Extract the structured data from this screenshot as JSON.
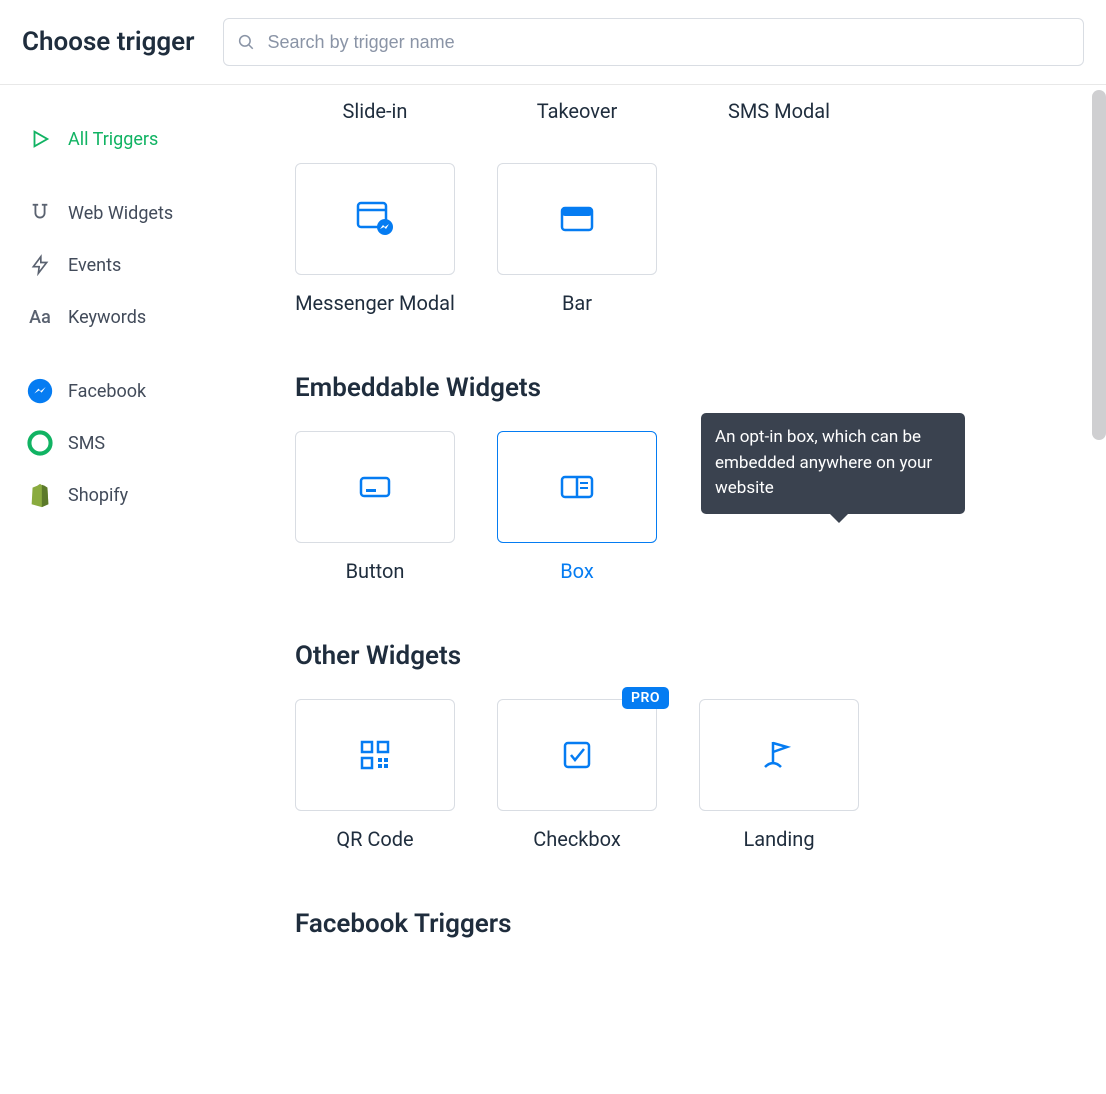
{
  "header": {
    "title": "Choose trigger",
    "search_placeholder": "Search by trigger name"
  },
  "sidebar": {
    "items": [
      {
        "label": "All Triggers",
        "icon": "play-icon",
        "active": true
      },
      {
        "label": "Web Widgets",
        "icon": "magnet-icon",
        "active": false
      },
      {
        "label": "Events",
        "icon": "lightning-icon",
        "active": false
      },
      {
        "label": "Keywords",
        "icon": "text-aa-icon",
        "active": false
      }
    ],
    "channels": [
      {
        "label": "Facebook",
        "icon": "messenger-circle-icon",
        "color": "#057cf2"
      },
      {
        "label": "SMS",
        "icon": "chat-circle-icon",
        "color": "#11b363"
      },
      {
        "label": "Shopify",
        "icon": "shopify-icon",
        "color": "#6a863a"
      }
    ]
  },
  "content": {
    "top_labels": [
      "Slide-in",
      "Takeover",
      "SMS Modal"
    ],
    "row2": [
      {
        "label": "Messenger Modal",
        "icon": "messenger-modal-icon"
      },
      {
        "label": "Bar",
        "icon": "bar-icon"
      }
    ],
    "sections": [
      {
        "title": "Embeddable Widgets",
        "items": [
          {
            "label": "Button",
            "icon": "button-icon",
            "selected": false
          },
          {
            "label": "Box",
            "icon": "box-icon",
            "selected": true
          }
        ]
      },
      {
        "title": "Other Widgets",
        "items": [
          {
            "label": "QR Code",
            "icon": "qr-icon"
          },
          {
            "label": "Checkbox",
            "icon": "checkbox-icon",
            "badge": "PRO"
          },
          {
            "label": "Landing",
            "icon": "landing-icon"
          }
        ]
      },
      {
        "title": "Facebook Triggers",
        "items": []
      }
    ]
  },
  "tooltip": {
    "text": "An opt-in box, which can be embedded anywhere on your website"
  },
  "badge": {
    "pro": "PRO"
  }
}
